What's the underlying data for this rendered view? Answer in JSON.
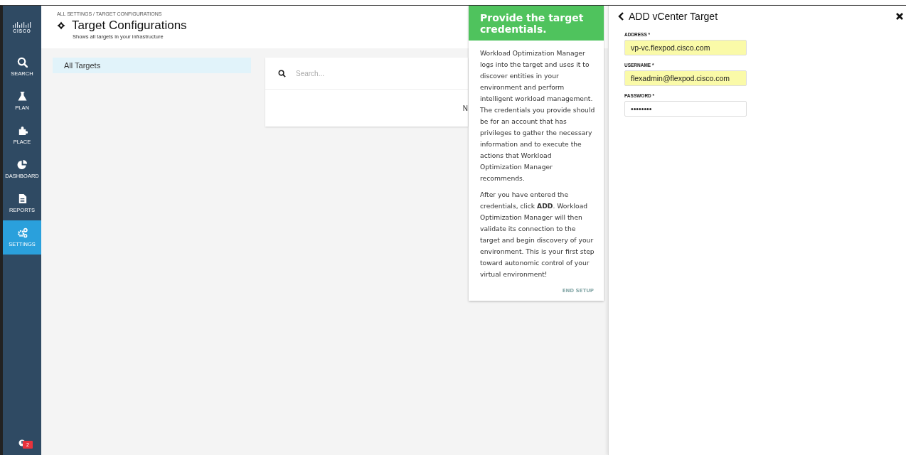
{
  "sidebar": {
    "logo": "CISCO",
    "items": [
      {
        "label": "SEARCH",
        "kind": "search",
        "selected": false
      },
      {
        "label": "PLAN",
        "kind": "plan",
        "selected": false
      },
      {
        "label": "PLACE",
        "kind": "place",
        "selected": false
      },
      {
        "label": "DASHBOARD",
        "kind": "dashboard",
        "selected": false
      },
      {
        "label": "REPORTS",
        "kind": "reports",
        "selected": false
      },
      {
        "label": "SETTINGS",
        "kind": "settings",
        "selected": true
      }
    ],
    "notifications": {
      "count": "2"
    }
  },
  "header": {
    "breadcrumb": "ALL SETTINGS / TARGET CONFIGURATIONS",
    "title": "Target Configurations",
    "subtitle": "Shows all targets in your infrastructure"
  },
  "target_list": [
    {
      "label": "All Targets",
      "selected": true
    }
  ],
  "search": {
    "placeholder": "Search...",
    "column_3": "N"
  },
  "tip": {
    "title": "Provide the target credentials.",
    "paragraphs": [
      "Workload Optimization Manager logs into the target and uses it to discover entities in your environment and perform intelligent workload management. The credentials you provide should be for an account that has privileges to gather the necessary information and to execute the actions that Workload Optimization Manager recommends.",
      "After you have entered the credentials, click **ADD**. Workload Optimization Manager will then validate its connection to the target and begin discovery of your environment. This is your first step toward autonomic control of your virtual environment!"
    ],
    "end_button": "END SETUP"
  },
  "panel": {
    "title": "ADD vCenter Target",
    "fields": [
      {
        "label": "ADDRESS *",
        "value": "vp-vc.flexpod.cisco.com",
        "autofilled": true
      },
      {
        "label": "USERNAME *",
        "value": "flexadmin@flexpod.cisco.com",
        "autofilled": true
      },
      {
        "label": "PASSWORD *",
        "value": "••••••••",
        "autofilled": false
      }
    ]
  }
}
